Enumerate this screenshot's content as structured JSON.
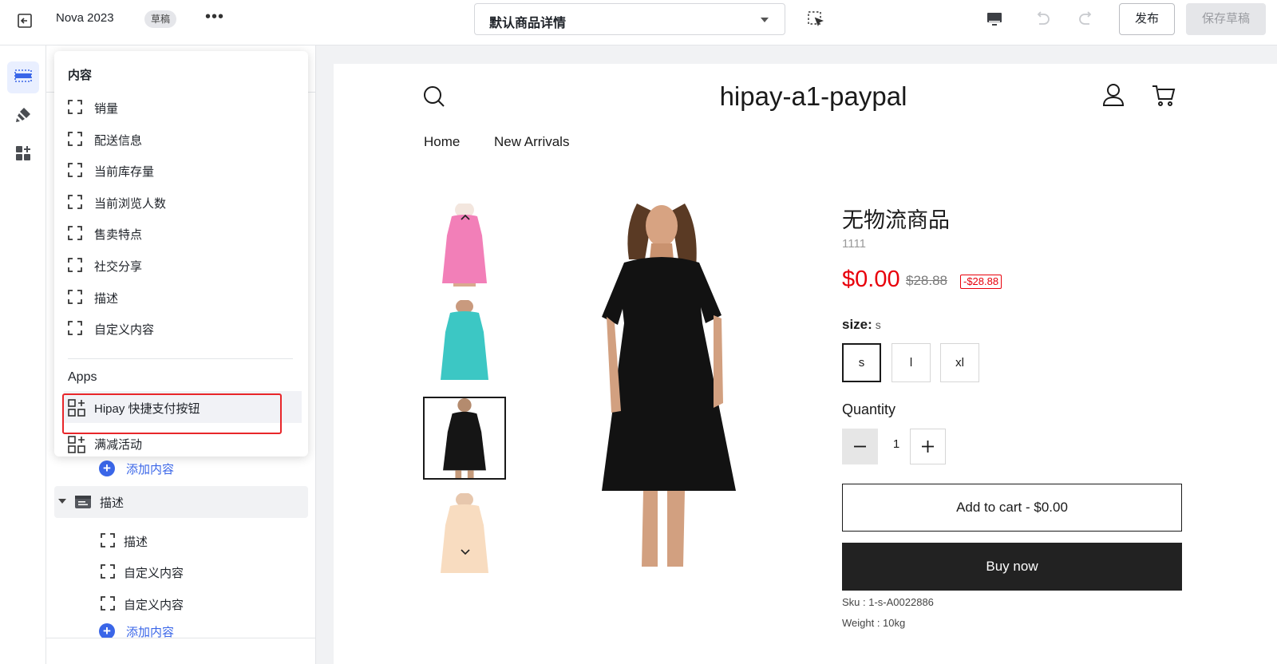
{
  "topbar": {
    "theme_name": "Nova 2023",
    "status_badge": "草稿",
    "more": "•••",
    "template_select": "默认商品详情",
    "publish": "发布",
    "save_draft": "保存草稿"
  },
  "popover": {
    "content_heading": "内容",
    "content_items": [
      {
        "label": "销量",
        "icon": "block-icon"
      },
      {
        "label": "配送信息",
        "icon": "block-icon"
      },
      {
        "label": "当前库存量",
        "icon": "block-icon"
      },
      {
        "label": "当前浏览人数",
        "icon": "block-icon"
      },
      {
        "label": "售卖特点",
        "icon": "block-icon"
      },
      {
        "label": "社交分享",
        "icon": "block-icon"
      },
      {
        "label": "描述",
        "icon": "block-icon"
      },
      {
        "label": "自定义内容",
        "icon": "block-icon"
      }
    ],
    "apps_heading": "Apps",
    "app_items": [
      {
        "label": "Hipay 快捷支付按钮",
        "icon": "app-block-icon",
        "highlighted": true
      },
      {
        "label": "满减活动",
        "icon": "app-block-icon"
      }
    ]
  },
  "sidebar": {
    "add_content_1": "添加内容",
    "section_description": "描述",
    "section_items": [
      {
        "label": "描述"
      },
      {
        "label": "自定义内容"
      },
      {
        "label": "自定义内容"
      }
    ],
    "add_content_2": "添加内容"
  },
  "store": {
    "title": "hipay-a1-paypal",
    "nav": [
      "Home",
      "New Arrivals"
    ],
    "product": {
      "title": "无物流商品",
      "subtitle": "1111",
      "price": "$0.00",
      "compare_price": "$28.88",
      "save_badge": "-$28.88",
      "size_label": "size:",
      "size_selected": "s",
      "sizes": [
        "s",
        "l",
        "xl"
      ],
      "quantity_label": "Quantity",
      "quantity": "1",
      "add_to_cart": "Add to cart  -  $0.00",
      "buy_now": "Buy now",
      "sku": "Sku : 1-s-A0022886",
      "weight": "Weight : 10kg"
    },
    "thumbnails": [
      {
        "color": "#f27fb8",
        "name": "pink-dress"
      },
      {
        "color": "#3cc7c4",
        "name": "teal-dress"
      },
      {
        "color": "#151515",
        "name": "black-dress",
        "selected": true
      },
      {
        "color": "#f8dcc0",
        "name": "beige-dress"
      }
    ]
  },
  "colors": {
    "accent": "#3a66e8",
    "price_red": "#e8000b",
    "highlight_border": "#e8262a",
    "buy_button": "#222222"
  }
}
